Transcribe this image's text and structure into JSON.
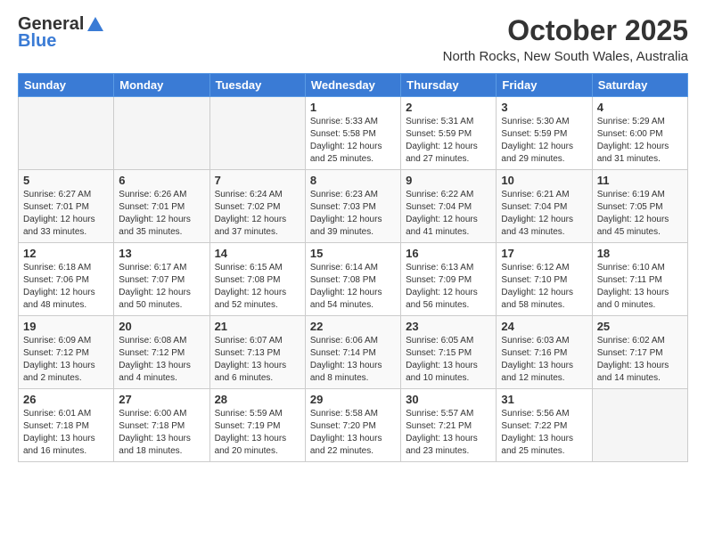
{
  "header": {
    "logo_general": "General",
    "logo_blue": "Blue",
    "month_title": "October 2025",
    "location": "North Rocks, New South Wales, Australia"
  },
  "days_of_week": [
    "Sunday",
    "Monday",
    "Tuesday",
    "Wednesday",
    "Thursday",
    "Friday",
    "Saturday"
  ],
  "weeks": [
    [
      {
        "day": "",
        "info": ""
      },
      {
        "day": "",
        "info": ""
      },
      {
        "day": "",
        "info": ""
      },
      {
        "day": "1",
        "info": "Sunrise: 5:33 AM\nSunset: 5:58 PM\nDaylight: 12 hours\nand 25 minutes."
      },
      {
        "day": "2",
        "info": "Sunrise: 5:31 AM\nSunset: 5:59 PM\nDaylight: 12 hours\nand 27 minutes."
      },
      {
        "day": "3",
        "info": "Sunrise: 5:30 AM\nSunset: 5:59 PM\nDaylight: 12 hours\nand 29 minutes."
      },
      {
        "day": "4",
        "info": "Sunrise: 5:29 AM\nSunset: 6:00 PM\nDaylight: 12 hours\nand 31 minutes."
      }
    ],
    [
      {
        "day": "5",
        "info": "Sunrise: 6:27 AM\nSunset: 7:01 PM\nDaylight: 12 hours\nand 33 minutes."
      },
      {
        "day": "6",
        "info": "Sunrise: 6:26 AM\nSunset: 7:01 PM\nDaylight: 12 hours\nand 35 minutes."
      },
      {
        "day": "7",
        "info": "Sunrise: 6:24 AM\nSunset: 7:02 PM\nDaylight: 12 hours\nand 37 minutes."
      },
      {
        "day": "8",
        "info": "Sunrise: 6:23 AM\nSunset: 7:03 PM\nDaylight: 12 hours\nand 39 minutes."
      },
      {
        "day": "9",
        "info": "Sunrise: 6:22 AM\nSunset: 7:04 PM\nDaylight: 12 hours\nand 41 minutes."
      },
      {
        "day": "10",
        "info": "Sunrise: 6:21 AM\nSunset: 7:04 PM\nDaylight: 12 hours\nand 43 minutes."
      },
      {
        "day": "11",
        "info": "Sunrise: 6:19 AM\nSunset: 7:05 PM\nDaylight: 12 hours\nand 45 minutes."
      }
    ],
    [
      {
        "day": "12",
        "info": "Sunrise: 6:18 AM\nSunset: 7:06 PM\nDaylight: 12 hours\nand 48 minutes."
      },
      {
        "day": "13",
        "info": "Sunrise: 6:17 AM\nSunset: 7:07 PM\nDaylight: 12 hours\nand 50 minutes."
      },
      {
        "day": "14",
        "info": "Sunrise: 6:15 AM\nSunset: 7:08 PM\nDaylight: 12 hours\nand 52 minutes."
      },
      {
        "day": "15",
        "info": "Sunrise: 6:14 AM\nSunset: 7:08 PM\nDaylight: 12 hours\nand 54 minutes."
      },
      {
        "day": "16",
        "info": "Sunrise: 6:13 AM\nSunset: 7:09 PM\nDaylight: 12 hours\nand 56 minutes."
      },
      {
        "day": "17",
        "info": "Sunrise: 6:12 AM\nSunset: 7:10 PM\nDaylight: 12 hours\nand 58 minutes."
      },
      {
        "day": "18",
        "info": "Sunrise: 6:10 AM\nSunset: 7:11 PM\nDaylight: 13 hours\nand 0 minutes."
      }
    ],
    [
      {
        "day": "19",
        "info": "Sunrise: 6:09 AM\nSunset: 7:12 PM\nDaylight: 13 hours\nand 2 minutes."
      },
      {
        "day": "20",
        "info": "Sunrise: 6:08 AM\nSunset: 7:12 PM\nDaylight: 13 hours\nand 4 minutes."
      },
      {
        "day": "21",
        "info": "Sunrise: 6:07 AM\nSunset: 7:13 PM\nDaylight: 13 hours\nand 6 minutes."
      },
      {
        "day": "22",
        "info": "Sunrise: 6:06 AM\nSunset: 7:14 PM\nDaylight: 13 hours\nand 8 minutes."
      },
      {
        "day": "23",
        "info": "Sunrise: 6:05 AM\nSunset: 7:15 PM\nDaylight: 13 hours\nand 10 minutes."
      },
      {
        "day": "24",
        "info": "Sunrise: 6:03 AM\nSunset: 7:16 PM\nDaylight: 13 hours\nand 12 minutes."
      },
      {
        "day": "25",
        "info": "Sunrise: 6:02 AM\nSunset: 7:17 PM\nDaylight: 13 hours\nand 14 minutes."
      }
    ],
    [
      {
        "day": "26",
        "info": "Sunrise: 6:01 AM\nSunset: 7:18 PM\nDaylight: 13 hours\nand 16 minutes."
      },
      {
        "day": "27",
        "info": "Sunrise: 6:00 AM\nSunset: 7:18 PM\nDaylight: 13 hours\nand 18 minutes."
      },
      {
        "day": "28",
        "info": "Sunrise: 5:59 AM\nSunset: 7:19 PM\nDaylight: 13 hours\nand 20 minutes."
      },
      {
        "day": "29",
        "info": "Sunrise: 5:58 AM\nSunset: 7:20 PM\nDaylight: 13 hours\nand 22 minutes."
      },
      {
        "day": "30",
        "info": "Sunrise: 5:57 AM\nSunset: 7:21 PM\nDaylight: 13 hours\nand 23 minutes."
      },
      {
        "day": "31",
        "info": "Sunrise: 5:56 AM\nSunset: 7:22 PM\nDaylight: 13 hours\nand 25 minutes."
      },
      {
        "day": "",
        "info": ""
      }
    ]
  ]
}
